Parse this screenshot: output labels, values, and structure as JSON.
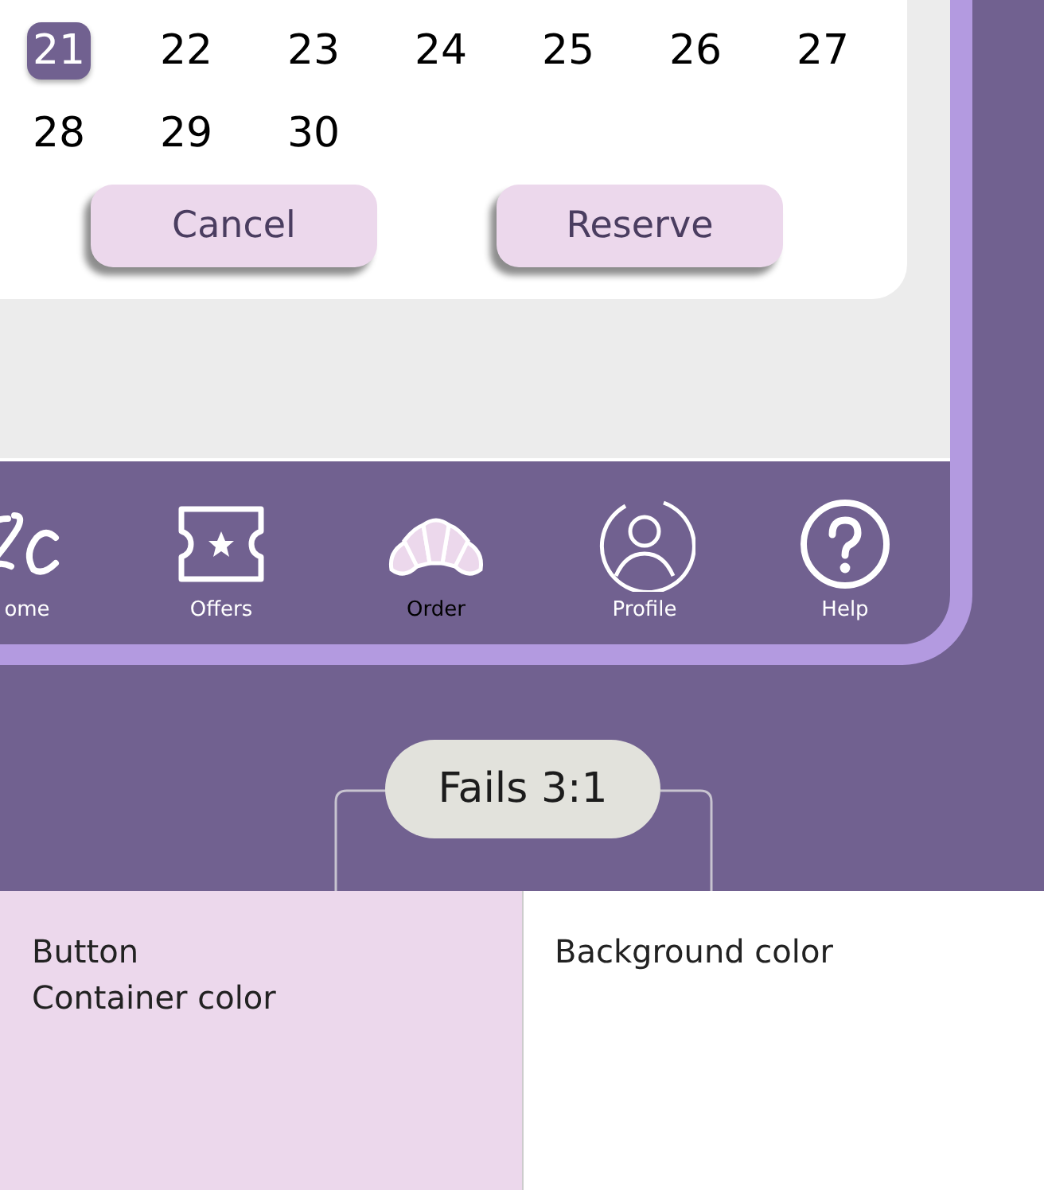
{
  "calendar": {
    "days": [
      {
        "label": "21",
        "selected": true
      },
      {
        "label": "22",
        "selected": false
      },
      {
        "label": "23",
        "selected": false
      },
      {
        "label": "24",
        "selected": false
      },
      {
        "label": "25",
        "selected": false
      },
      {
        "label": "26",
        "selected": false
      },
      {
        "label": "27",
        "selected": false
      },
      {
        "label": "28",
        "selected": false
      },
      {
        "label": "29",
        "selected": false
      },
      {
        "label": "30",
        "selected": false
      }
    ]
  },
  "buttons": [
    {
      "label": "Cancel"
    },
    {
      "label": "Reserve"
    }
  ],
  "nav": [
    {
      "label": "ome",
      "selected": false
    },
    {
      "label": "Offers",
      "selected": false
    },
    {
      "label": "Order",
      "selected": true
    },
    {
      "label": "Profile",
      "selected": false
    },
    {
      "label": "Help",
      "selected": false
    }
  ],
  "callout": {
    "label": "Fails 3:1"
  },
  "swatches": [
    {
      "label": "Button\nContainer color",
      "color": "#ecd8ec"
    },
    {
      "label": "Background color",
      "color": "#ffffff"
    }
  ]
}
